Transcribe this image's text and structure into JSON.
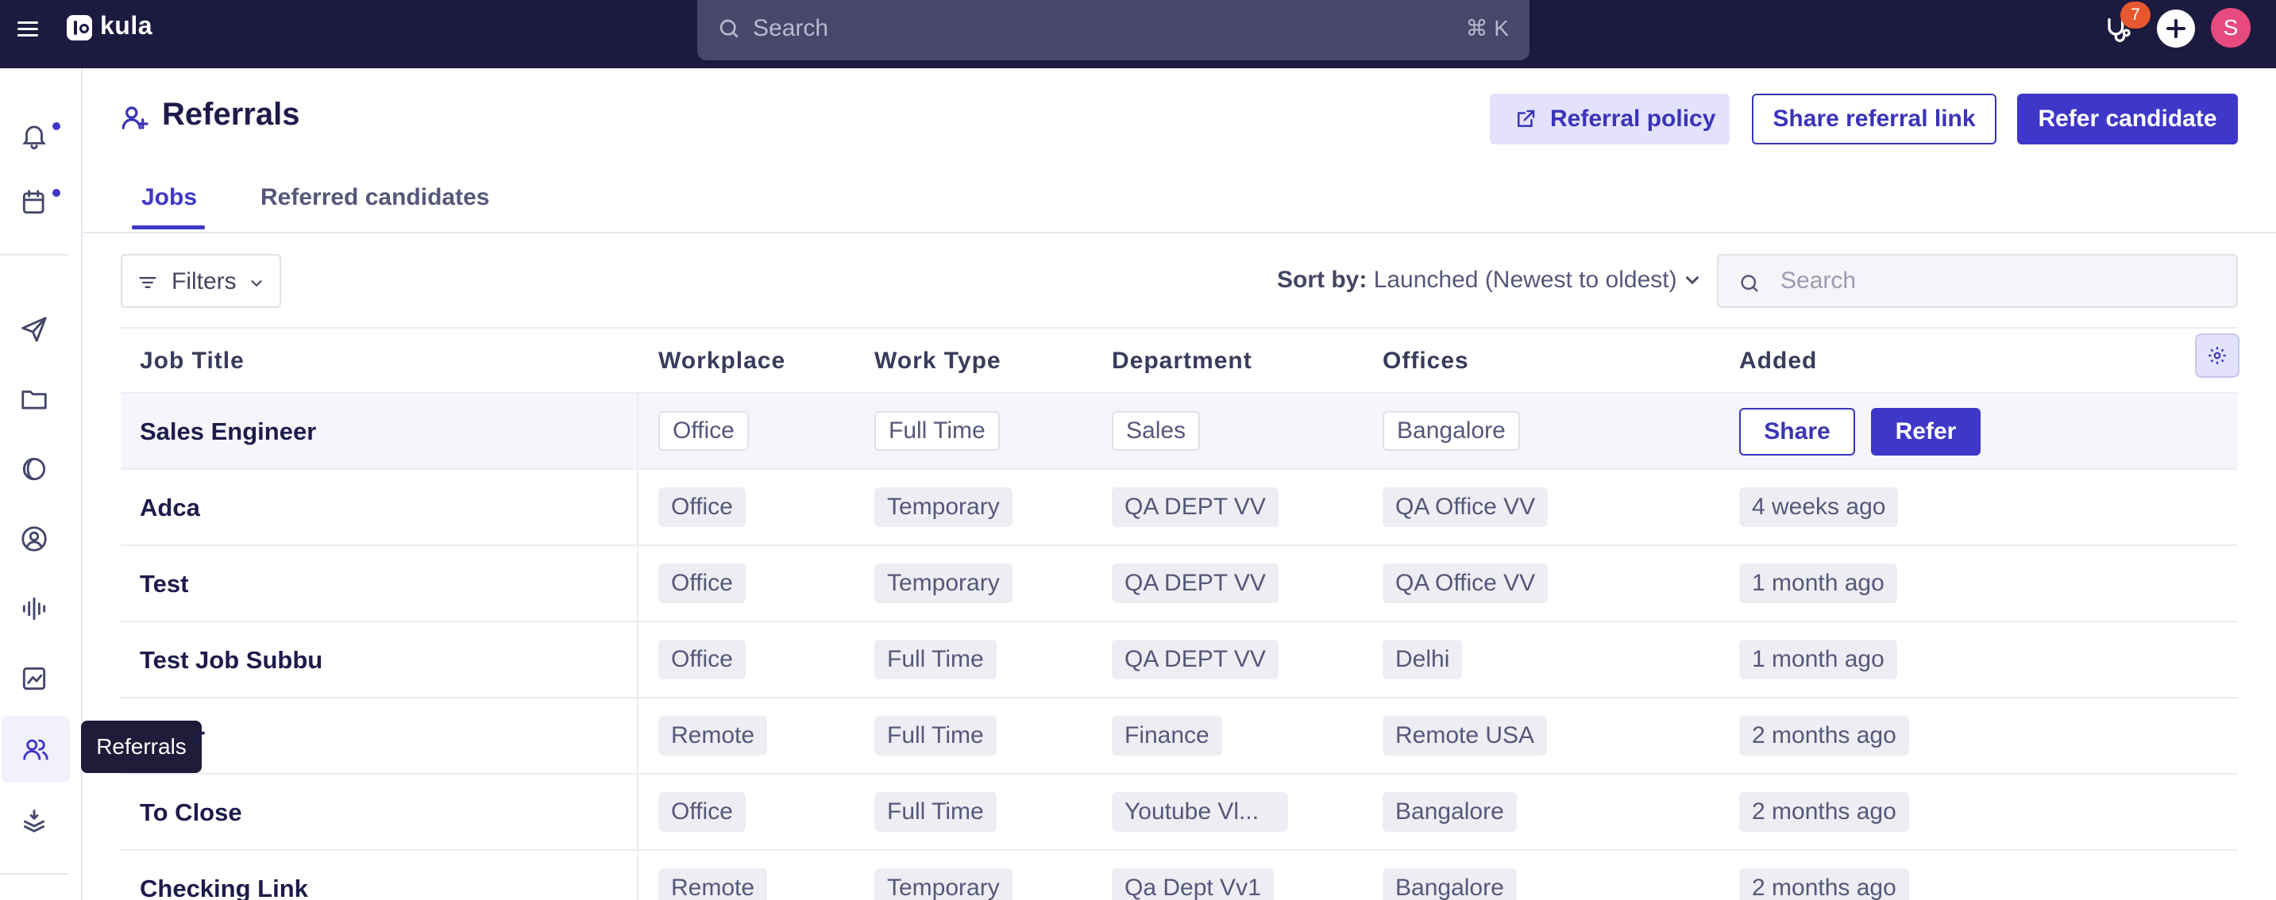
{
  "app": {
    "name": "kula"
  },
  "topbar": {
    "search_placeholder": "Search",
    "search_shortcut": "⌘ K",
    "notification_count": "7",
    "avatar_initial": "S"
  },
  "sidebar": {
    "icons": [
      "bell-icon",
      "calendar-icon",
      "send-icon",
      "folder-icon",
      "half-circle-icon",
      "user-circle-icon",
      "audio-wave-icon",
      "chart-icon",
      "referrals-icon",
      "layers-icon"
    ],
    "tooltip": "Referrals",
    "accent": "#3f37c9"
  },
  "header": {
    "title": "Referrals",
    "referral_policy_label": "Referral policy",
    "share_link_label": "Share referral link",
    "refer_candidate_label": "Refer candidate"
  },
  "tabs": [
    {
      "label": "Jobs",
      "active": true
    },
    {
      "label": "Referred candidates",
      "active": false
    }
  ],
  "toolbar": {
    "filters_label": "Filters",
    "sort_label": "Sort by:",
    "sort_value": "Launched (Newest to oldest)",
    "search_placeholder": "Search"
  },
  "table": {
    "columns": [
      "Job Title",
      "Workplace",
      "Work Type",
      "Department",
      "Offices",
      "Added"
    ],
    "row_actions": {
      "share": "Share",
      "refer": "Refer"
    },
    "rows": [
      {
        "title": "Sales Engineer",
        "workplace": "Office",
        "work_type": "Full Time",
        "department": "Sales",
        "offices": "Bangalore",
        "added": ""
      },
      {
        "title": "Adca",
        "workplace": "Office",
        "work_type": "Temporary",
        "department": "QA DEPT VV",
        "offices": "QA Office VV",
        "added": "4 weeks ago"
      },
      {
        "title": "Test",
        "workplace": "Office",
        "work_type": "Temporary",
        "department": "QA DEPT VV",
        "offices": "QA Office VV",
        "added": "1 month ago"
      },
      {
        "title": "Test Job Subbu",
        "workplace": "Office",
        "work_type": "Full Time",
        "department": "QA DEPT VV",
        "offices": "Delhi",
        "added": "1 month ago"
      },
      {
        "title": "r",
        "workplace": "Remote",
        "work_type": "Full Time",
        "department": "Finance",
        "offices": "Remote USA",
        "added": "2 months ago"
      },
      {
        "title": "To Close",
        "workplace": "Office",
        "work_type": "Full Time",
        "department": "Youtube Vl...",
        "offices": "Bangalore",
        "added": "2 months ago"
      },
      {
        "title": "Checking Link",
        "workplace": "Remote",
        "work_type": "Temporary",
        "department": "Qa Dept Vv1",
        "offices": "Bangalore",
        "added": "2 months ago"
      }
    ]
  }
}
